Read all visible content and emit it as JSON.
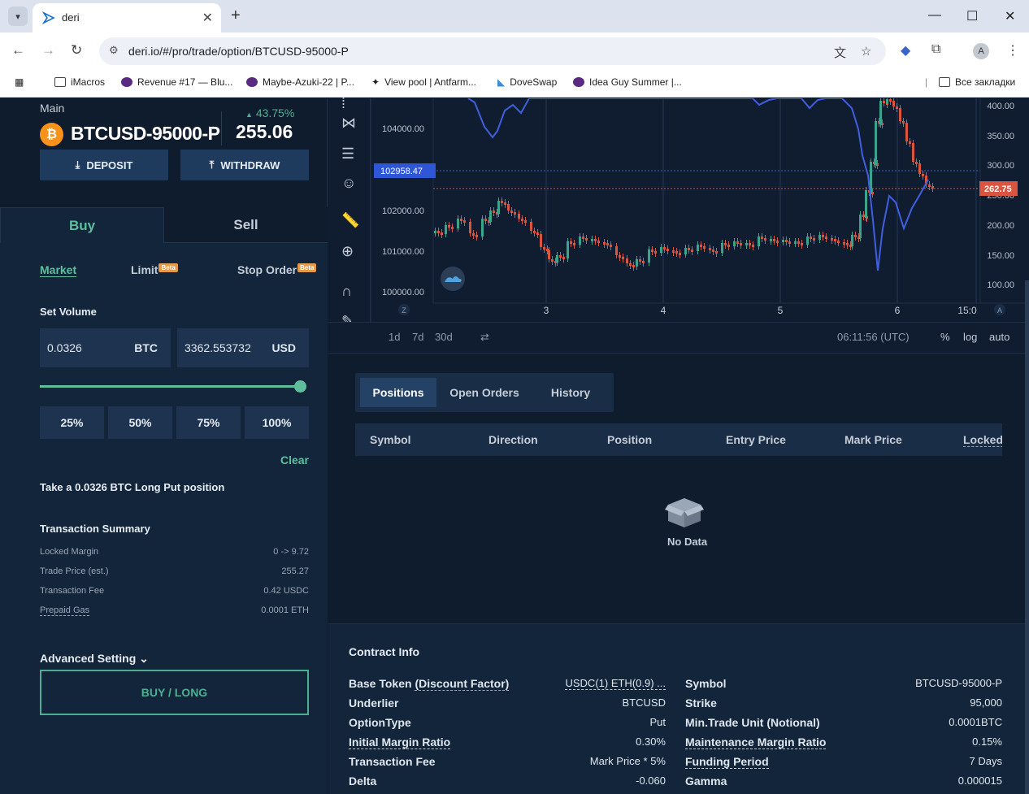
{
  "browser": {
    "tab_title": "deri",
    "url": "deri.io/#/pro/trade/option/BTCUSD-95000-P",
    "profile_initial": "A",
    "bookmarks": [
      {
        "label": "iMacros"
      },
      {
        "label": "Revenue #17 — Blu..."
      },
      {
        "label": "Maybe-Azuki-22 | P..."
      },
      {
        "label": "View pool | Antfarm..."
      },
      {
        "label": "DoveSwap"
      },
      {
        "label": "Idea Guy Summer |..."
      }
    ],
    "all_bookmarks": "Все закладки"
  },
  "header": {
    "account": "Main",
    "coin_glyph": "₿",
    "symbol": "BTCUSD-95000-P",
    "change": "43.75%",
    "price": "255.06",
    "deposit": "DEPOSIT",
    "withdraw": "WITHDRAW"
  },
  "order": {
    "tab_buy": "Buy",
    "tab_sell": "Sell",
    "type_market": "Market",
    "type_limit": "Limit",
    "type_stop": "Stop Order",
    "beta": "Beta",
    "set_volume": "Set Volume",
    "vol_btc": "0.0326",
    "unit_btc": "BTC",
    "vol_usd": "3362.553732",
    "unit_usd": "USD",
    "slider_fraction": 1.0,
    "pct": [
      "25%",
      "50%",
      "75%",
      "100%"
    ],
    "clear": "Clear",
    "take_text": "Take a 0.0326 BTC Long Put position",
    "summary_title": "Transaction Summary",
    "summary": [
      {
        "label": "Locked Margin",
        "value": "0 -> 9.72"
      },
      {
        "label": "Trade Price (est.)",
        "value": "255.27"
      },
      {
        "label": "Transaction Fee",
        "value": "0.42 USDC"
      },
      {
        "label": "Prepaid Gas",
        "value": "0.0001 ETH"
      }
    ],
    "advanced": "Advanced Setting",
    "buy_long": "BUY / LONG"
  },
  "chart": {
    "left_ticks": [
      "104000.00",
      "102000.00",
      "101000.00",
      "100000.00"
    ],
    "left_marker": "102958.47",
    "right_ticks": [
      "400.00",
      "350.00",
      "300.00",
      "250.00",
      "200.00",
      "150.00",
      "100.00"
    ],
    "right_marker": "262.75",
    "x_ticks": [
      "3",
      "4",
      "5",
      "6",
      "15:0"
    ],
    "z_label": "Z",
    "a_label": "A",
    "ranges": [
      "1d",
      "7d",
      "30d"
    ],
    "clock": "06:11:56 (UTC)",
    "opt_pct": "%",
    "opt_log": "log",
    "opt_auto": "auto"
  },
  "positions": {
    "tabs": [
      "Positions",
      "Open Orders",
      "History"
    ],
    "columns": [
      "Symbol",
      "Direction",
      "Position",
      "Entry Price",
      "Mark Price",
      "Locked M"
    ],
    "empty": "No Data"
  },
  "contract": {
    "title": "Contract Info",
    "left": [
      {
        "label": "Base Token",
        "label2": "(Discount Factor)",
        "value": "USDC(1) ETH(0.9) ..."
      },
      {
        "label": "Underlier",
        "value": "BTCUSD"
      },
      {
        "label": "OptionType",
        "value": "Put"
      },
      {
        "label": "Initial Margin Ratio",
        "value": "0.30%"
      },
      {
        "label": "Transaction Fee",
        "value": "Mark Price * 5%"
      },
      {
        "label": "Delta",
        "value": "-0.060"
      }
    ],
    "right": [
      {
        "label": "Symbol",
        "value": "BTCUSD-95000-P"
      },
      {
        "label": "Strike",
        "value": "95,000"
      },
      {
        "label": "Min.Trade Unit (Notional)",
        "value": "0.0001BTC"
      },
      {
        "label": "Maintenance Margin Ratio",
        "value": "0.15%"
      },
      {
        "label": "Funding Period",
        "value": "7 Days"
      },
      {
        "label": "Gamma",
        "value": "0.000015"
      }
    ]
  }
}
